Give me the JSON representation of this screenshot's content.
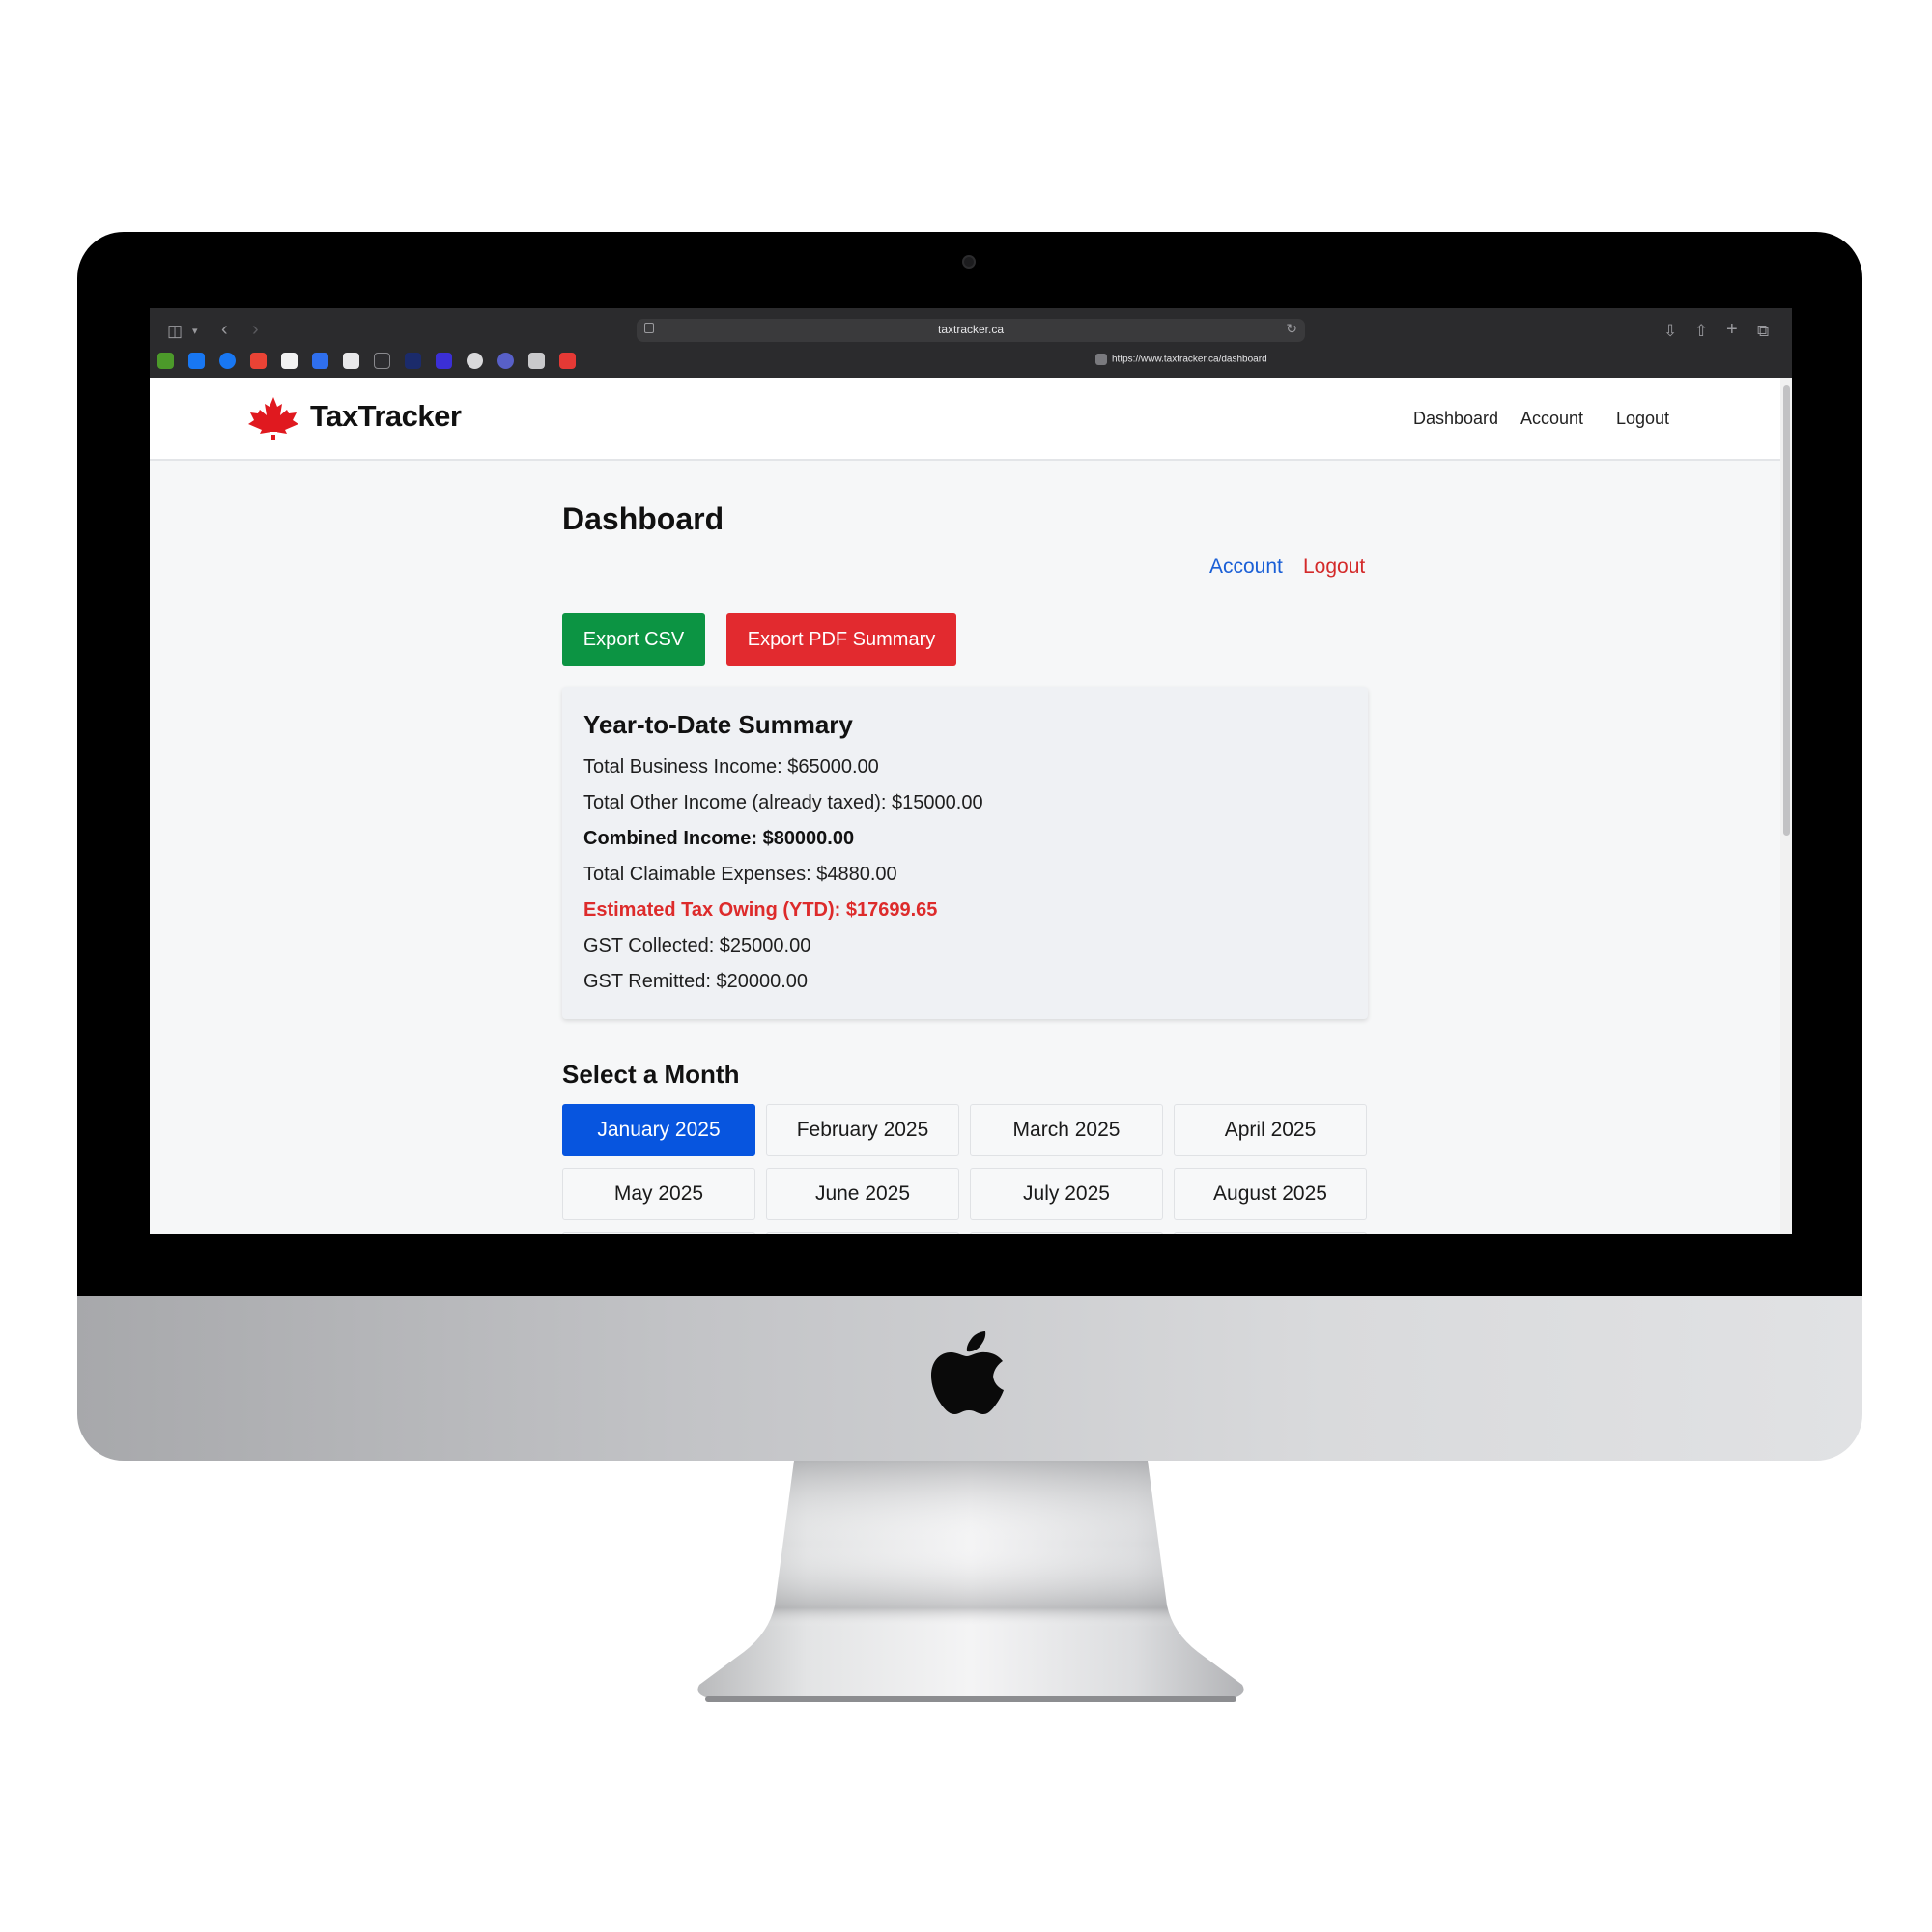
{
  "browser": {
    "address": "taxtracker.ca",
    "hover_url": "https://www.taxtracker.ca/dashboard"
  },
  "site": {
    "brand": "TaxTracker",
    "nav": [
      "Dashboard",
      "Account",
      "Logout"
    ]
  },
  "dashboard": {
    "title": "Dashboard",
    "account_link": "Account",
    "logout_link": "Logout",
    "export_csv": "Export CSV",
    "export_pdf": "Export PDF Summary",
    "summary": {
      "title": "Year-to-Date Summary",
      "business_income": "Total Business Income: $65000.00",
      "other_income": "Total Other Income (already taxed): $15000.00",
      "combined_income": "Combined Income: $80000.00",
      "claimable_expenses": "Total Claimable Expenses: $4880.00",
      "estimated_tax": "Estimated Tax Owing (YTD): $17699.65",
      "gst_collected": "GST Collected: $25000.00",
      "gst_remitted": "GST Remitted: $20000.00"
    },
    "month_section_title": "Select a Month",
    "months": [
      "January 2025",
      "February 2025",
      "March 2025",
      "April 2025",
      "May 2025",
      "June 2025",
      "July 2025",
      "August 2025"
    ],
    "selected_month": "January 2025"
  },
  "colors": {
    "accent_blue": "#0755df",
    "csv_green": "#0c9443",
    "pdf_red": "#e22a2f",
    "tax_red": "#dd2b2b"
  }
}
